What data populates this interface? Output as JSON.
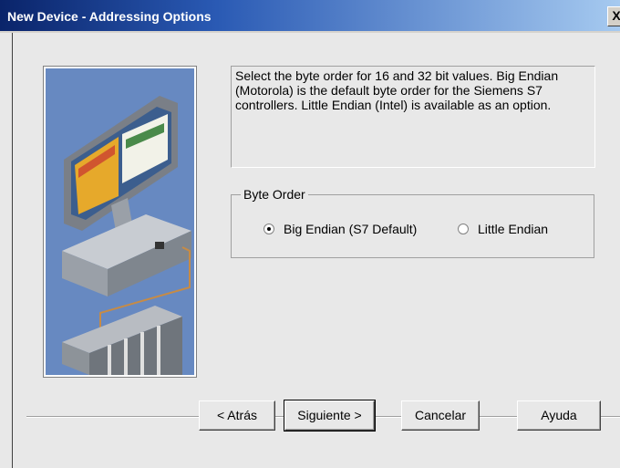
{
  "window": {
    "title": "New Device - Addressing Options",
    "close_label": "X"
  },
  "description": "Select the byte order for 16 and 32 bit values.  Big Endian (Motorola) is the default byte order for the Siemens S7 controllers.  Little Endian (Intel) is available as an option.",
  "byte_order": {
    "label": "Byte Order",
    "options": [
      {
        "label": "Big Endian (S7 Default)",
        "selected": true
      },
      {
        "label": "Little Endian",
        "selected": false
      }
    ]
  },
  "buttons": {
    "back": "< Atrás",
    "next": "Siguiente >",
    "cancel": "Cancelar",
    "help": "Ayuda"
  },
  "colors": {
    "title_start": "#0a246a",
    "illustration_bg": "#6789c1"
  }
}
